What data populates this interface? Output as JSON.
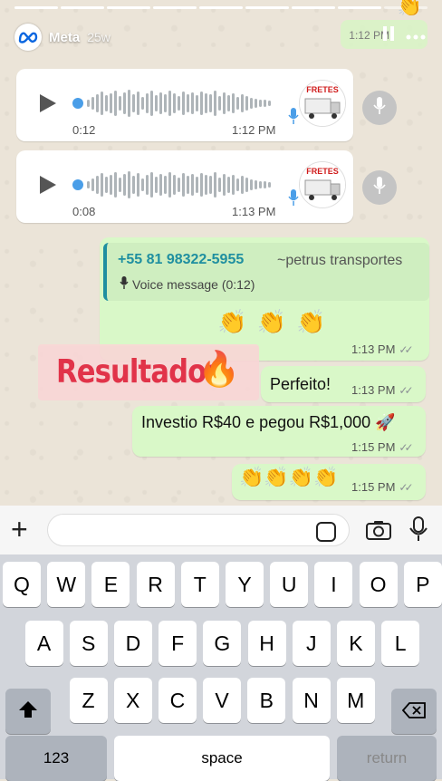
{
  "story": {
    "account": "Meta",
    "age": "25w",
    "progress_segments": 9,
    "progress_done": 8
  },
  "chat": {
    "top_partial_time": "1:12 PM",
    "audio_messages": [
      {
        "duration": "0:12",
        "time": "1:12 PM",
        "avatar_text": "FRETES"
      },
      {
        "duration": "0:08",
        "time": "1:13 PM",
        "avatar_text": "FRETES"
      }
    ],
    "quoted": {
      "number": "+55 81 98322-5955",
      "name": "~petrus transportes",
      "voice_label": "Voice message (0:12)"
    },
    "clap_message": {
      "emoji": "👏 👏 👏",
      "time": "1:13 PM"
    },
    "overlay": {
      "text": "Resultados",
      "emoji": "🔥"
    },
    "perfeito": {
      "text": "Perfeito!",
      "time": "1:13 PM"
    },
    "investio": {
      "text": "Investio R$40 e pegou R$1,000 🚀",
      "time": "1:15 PM"
    },
    "claps_last": {
      "emoji": "👏👏👏👏",
      "time": "1:15 PM"
    }
  },
  "keyboard": {
    "row1": [
      "Q",
      "W",
      "E",
      "R",
      "T",
      "Y",
      "U",
      "I",
      "O",
      "P"
    ],
    "row2": [
      "A",
      "S",
      "D",
      "F",
      "G",
      "H",
      "J",
      "K",
      "L"
    ],
    "row3": [
      "Z",
      "X",
      "C",
      "V",
      "B",
      "N",
      "M"
    ],
    "numbers_label": "123",
    "space_label": "space",
    "return_label": "return"
  },
  "icons": {
    "shift": "shift-icon",
    "backspace": "backspace-icon",
    "plus": "plus-icon",
    "camera": "camera-icon",
    "mic": "microphone-icon",
    "sticker": "sticker-icon"
  }
}
